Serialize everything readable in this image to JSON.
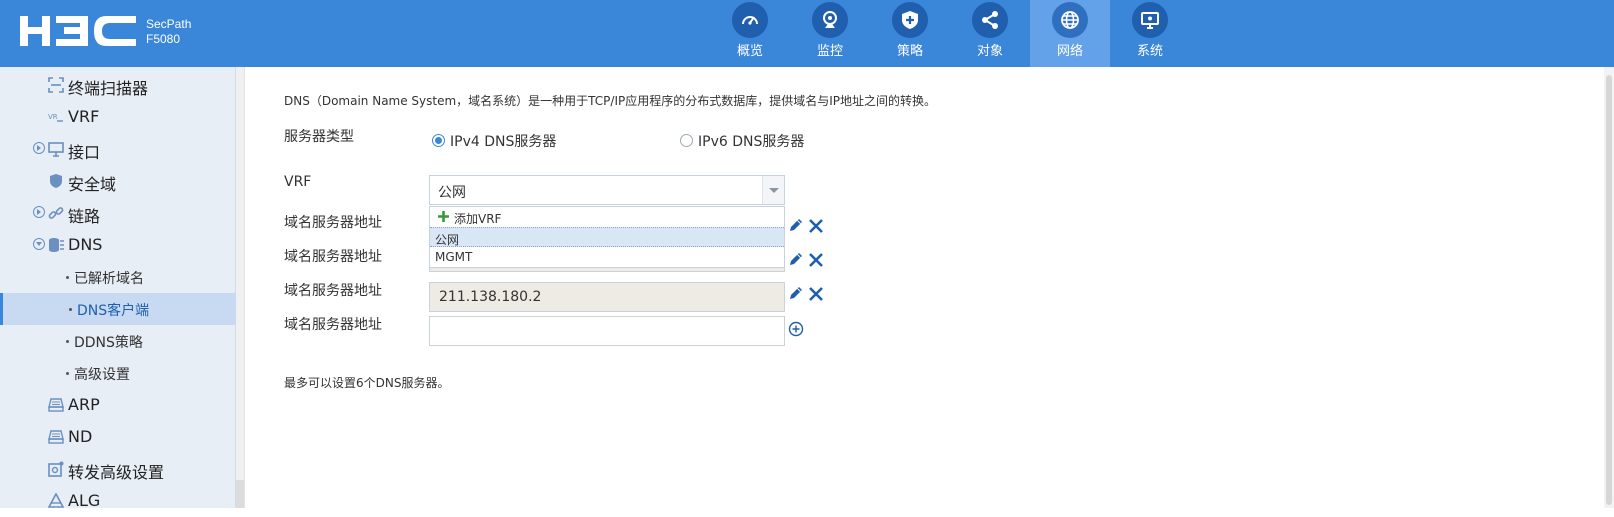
{
  "header": {
    "model_line1": "SecPath",
    "model_line2": "F5080",
    "tabs": [
      {
        "label": "概览",
        "icon": "gauge-icon"
      },
      {
        "label": "监控",
        "icon": "webcam-icon"
      },
      {
        "label": "策略",
        "icon": "shield-icon"
      },
      {
        "label": "对象",
        "icon": "share-icon"
      },
      {
        "label": "网络",
        "icon": "globe-icon"
      },
      {
        "label": "系统",
        "icon": "monitor-icon"
      }
    ],
    "active_tab": "网络"
  },
  "sidebar": {
    "items": [
      {
        "label": "终端扫描器",
        "icon": "scan-icon"
      },
      {
        "label": "VRF",
        "icon": "vrf-icon"
      },
      {
        "label": "接口",
        "icon": "interface-icon"
      },
      {
        "label": "安全域",
        "icon": "security-zone-icon"
      },
      {
        "label": "链路",
        "icon": "link-icon"
      },
      {
        "label": "DNS",
        "icon": "dns-icon"
      },
      {
        "label": "ARP",
        "icon": "arp-icon"
      },
      {
        "label": "ND",
        "icon": "nd-icon"
      },
      {
        "label": "转发高级设置",
        "icon": "forward-settings-icon"
      },
      {
        "label": "ALG",
        "icon": "alg-icon"
      }
    ],
    "dns_children": [
      {
        "label": "已解析域名"
      },
      {
        "label": "DNS客户端"
      },
      {
        "label": "DDNS策略"
      },
      {
        "label": "高级设置"
      }
    ],
    "selected": "DNS客户端"
  },
  "main": {
    "description": "DNS（Domain Name System，域名系统）是一种用于TCP/IP应用程序的分布式数据库，提供域名与IP地址之间的转换。",
    "server_type": {
      "label": "服务器类型",
      "options": [
        "IPv4 DNS服务器",
        "IPv6 DNS服务器"
      ],
      "selected": "IPv4 DNS服务器"
    },
    "vrf": {
      "label": "VRF",
      "value": "公网",
      "dropdown": {
        "add_label": "添加VRF",
        "options": [
          "公网",
          "MGMT"
        ],
        "highlighted": "公网"
      }
    },
    "servers": {
      "label": "域名服务器地址",
      "rows": [
        {
          "value": ""
        },
        {
          "value": ""
        },
        {
          "value": "211.138.180.2"
        },
        {
          "value": ""
        }
      ]
    },
    "note": "最多可以设置6个DNS服务器。"
  },
  "colors": {
    "header_bg": "#3a86d8",
    "active_tab_bg": "#63a2e8",
    "delete_icon": "#1f5fae",
    "add_vrf_plus": "#3a9a3a"
  }
}
